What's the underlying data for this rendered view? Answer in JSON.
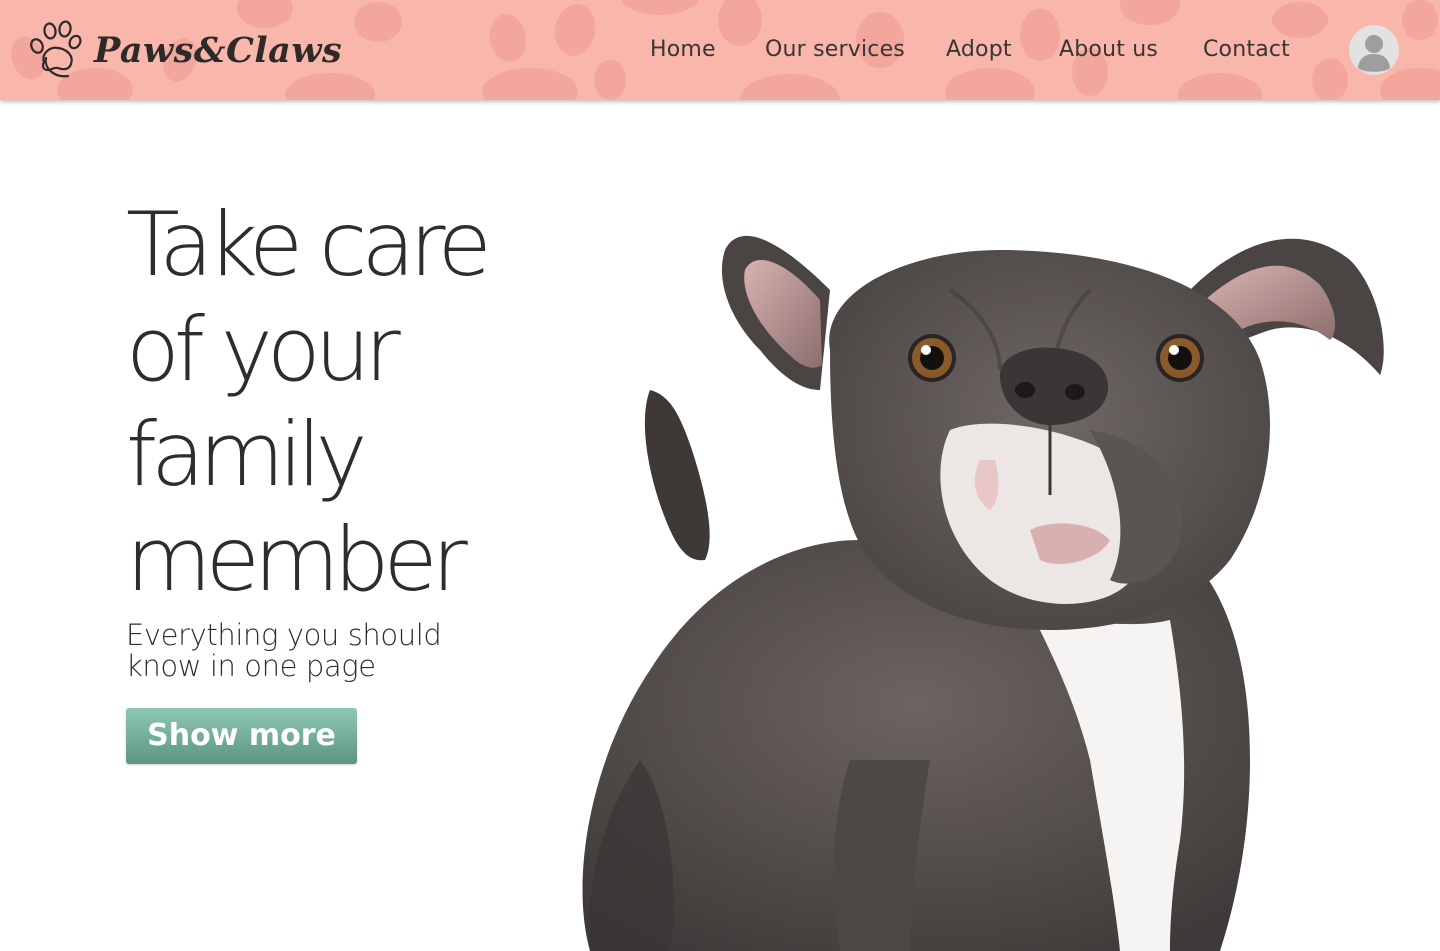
{
  "header": {
    "brand": "Paws&Claws",
    "background_color": "#f9b6ab",
    "paw_pattern_color": "#f2a79c",
    "nav": [
      {
        "label": "Home"
      },
      {
        "label": "Our services"
      },
      {
        "label": "Adopt"
      },
      {
        "label": "About us"
      },
      {
        "label": "Contact"
      }
    ],
    "avatar_icon": "user-avatar-icon"
  },
  "hero": {
    "title_lines": [
      "Take care",
      "of your",
      "family",
      "member"
    ],
    "subtitle": "Everything you should know in one page",
    "button_label": "Show more",
    "button_gradient": [
      "#8fc7b4",
      "#5d9585"
    ],
    "image": "dog-photo"
  },
  "colors": {
    "text": "#2d2d2d",
    "page_background": "#ffffff"
  }
}
